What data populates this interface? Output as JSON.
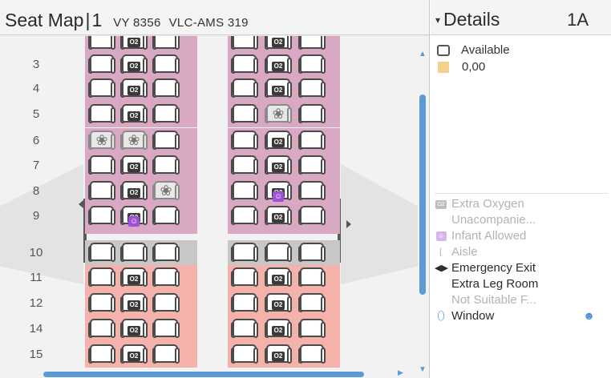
{
  "header": {
    "title": "Seat Map",
    "separator": "|",
    "number": "1",
    "flight": "VY 8356",
    "route": "VLC-AMS 319"
  },
  "details": {
    "caret": "▾",
    "title": "Details",
    "seat": "1A",
    "legend_top": [
      {
        "label": "Available",
        "icon": "seat-outline-icon"
      },
      {
        "label": "0,00",
        "icon": "price-swatch-icon",
        "color": "#f5cf8c"
      }
    ],
    "legend_bottom": [
      {
        "label": "Extra Oxygen",
        "icon": "oxygen-icon",
        "state": "muted"
      },
      {
        "label": "Unacompanie...",
        "icon": "",
        "state": "muted"
      },
      {
        "label": "Infant Allowed",
        "icon": "infant-icon",
        "state": "muted"
      },
      {
        "label": "Aisle",
        "icon": "aisle-icon",
        "state": "muted"
      },
      {
        "label": "Emergency Exit",
        "icon": "emergency-exit-icon",
        "state": "dark"
      },
      {
        "label": "Extra Leg Room",
        "icon": "",
        "state": "dark"
      },
      {
        "label": "Not Suitable F...",
        "icon": "",
        "state": "muted"
      },
      {
        "label": "Window",
        "icon": "window-icon",
        "state": "dark"
      }
    ]
  },
  "seatmap": {
    "o2_label": "O2",
    "rows": [
      {
        "label": "",
        "zone": "purple"
      },
      {
        "label": "3",
        "zone": "purple"
      },
      {
        "label": "4",
        "zone": "purple"
      },
      {
        "label": "5",
        "zone": "purple"
      },
      {
        "label": "6",
        "zone": "purple"
      },
      {
        "label": "7",
        "zone": "purple"
      },
      {
        "label": "8",
        "zone": "purple"
      },
      {
        "label": "9",
        "zone": "purple"
      },
      {
        "label": "10",
        "zone": "gray"
      },
      {
        "label": "11",
        "zone": "salmon"
      },
      {
        "label": "12",
        "zone": "salmon"
      },
      {
        "label": "14",
        "zone": "salmon"
      },
      {
        "label": "15",
        "zone": "salmon"
      }
    ]
  },
  "colors": {
    "zone_purple": "#d9a9c4",
    "zone_gray": "#c7c7c7",
    "zone_salmon": "#f4b2ab",
    "accent": "#5b9bd5",
    "infant": "#a24fd8"
  }
}
